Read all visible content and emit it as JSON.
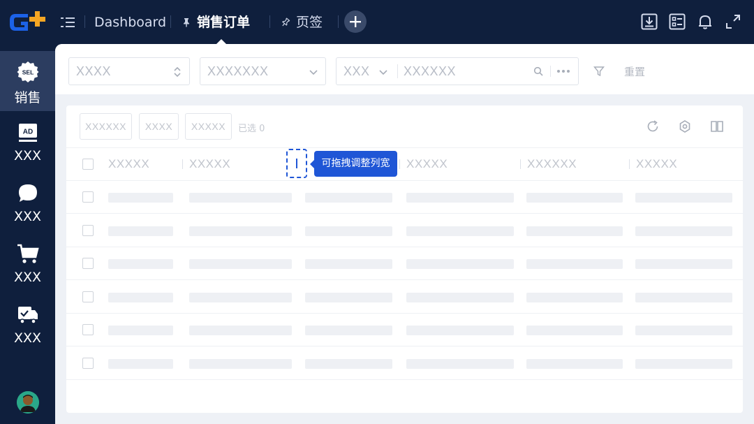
{
  "colors": {
    "navy": "#0f1f3d",
    "accent": "#1f56d6",
    "logo_blue": "#1c62e8",
    "logo_orange": "#f5a623"
  },
  "header": {
    "menu_icon": "menu-icon",
    "tabs": [
      {
        "label": "Dashboard",
        "icon": null
      },
      {
        "label": "销售订单",
        "icon": "pin-icon",
        "active": true
      },
      {
        "label": "页签",
        "icon": "pin-outline-icon"
      }
    ],
    "add_tab_icon": "plus-icon",
    "right_icons": [
      "download-icon",
      "checklist-icon",
      "bell-icon",
      "expand-icon"
    ]
  },
  "sidebar": {
    "items": [
      {
        "label": "销售",
        "icon": "sel-badge-icon",
        "badge": "SEL",
        "active": true
      },
      {
        "label": "XXX",
        "icon": "ad-icon",
        "badge": "AD"
      },
      {
        "label": "XXX",
        "icon": "chat-icon"
      },
      {
        "label": "XXX",
        "icon": "cart-icon"
      },
      {
        "label": "XXX",
        "icon": "truck-icon"
      }
    ],
    "avatar": "avatar"
  },
  "filters": {
    "select1": "XXXX",
    "select2": "XXXXXXX",
    "type_select": "XXX",
    "search": "XXXXXX",
    "reset": "重置"
  },
  "table": {
    "toolbar_buttons": [
      "XXXXXX",
      "XXXX",
      "XXXXX"
    ],
    "selected_count": "已选 0",
    "columns": [
      "XXXXX",
      "XXXXX",
      "",
      "XXXXX",
      "XXXXXX",
      "XXXXX"
    ],
    "tooltip": "可拖拽调整列宽",
    "row_count": 6
  }
}
